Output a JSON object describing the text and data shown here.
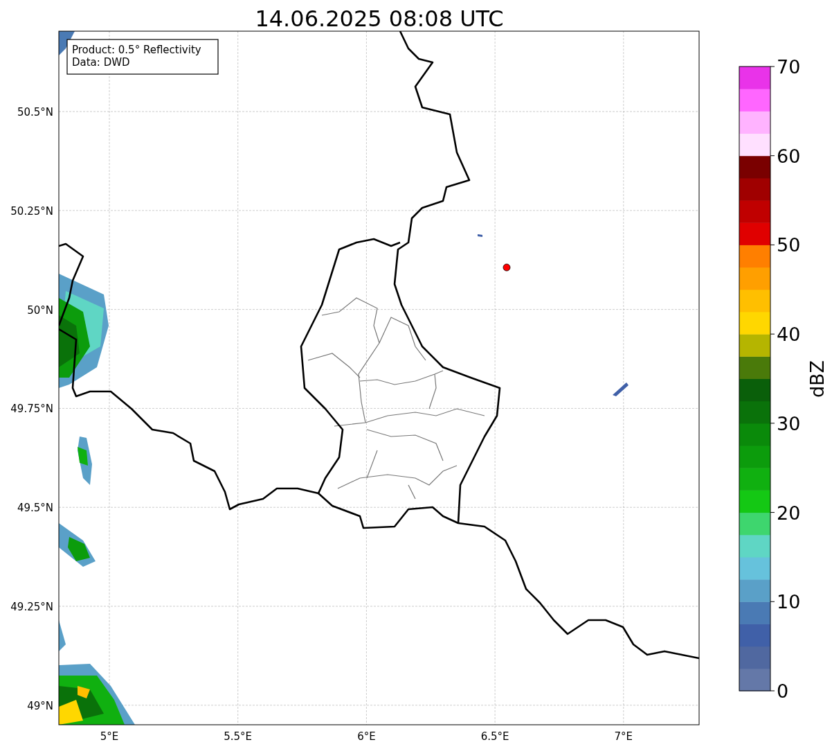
{
  "title": "14.06.2025 08:08 UTC",
  "legend": {
    "lines": [
      "Product: 0.5° Reflectivity",
      "Data: DWD"
    ]
  },
  "map": {
    "xtick_labels": [
      "5°E",
      "5.5°E",
      "6°E",
      "6.5°E",
      "7°E"
    ],
    "ytick_labels": [
      "50.5°N",
      "50.25°N",
      "50°N",
      "49.75°N",
      "49.5°N",
      "49.25°N",
      "49°N"
    ]
  },
  "colorbar": {
    "label": "dBZ",
    "tick_labels": [
      "70",
      "60",
      "50",
      "40",
      "30",
      "20",
      "10",
      "0"
    ],
    "bins": [
      {
        "color": "#6478a8"
      },
      {
        "color": "#5068a0"
      },
      {
        "color": "#4060a8"
      },
      {
        "color": "#4a7ab4"
      },
      {
        "color": "#5aa0c8"
      },
      {
        "color": "#66c2dc"
      },
      {
        "color": "#5fd6c4"
      },
      {
        "color": "#3ed66e"
      },
      {
        "color": "#14c814"
      },
      {
        "color": "#10b010"
      },
      {
        "color": "#0c9c0c"
      },
      {
        "color": "#0a8a0a"
      },
      {
        "color": "#0a720a"
      },
      {
        "color": "#0a5f0a"
      },
      {
        "color": "#4a7a0a"
      },
      {
        "color": "#b5b500"
      },
      {
        "color": "#ffd700"
      },
      {
        "color": "#ffbf00"
      },
      {
        "color": "#ff9f00"
      },
      {
        "color": "#ff7f00"
      },
      {
        "color": "#e00000"
      },
      {
        "color": "#c00000"
      },
      {
        "color": "#a00000"
      },
      {
        "color": "#7a0000"
      },
      {
        "color": "#ffe0ff"
      },
      {
        "color": "#ffb3ff"
      },
      {
        "color": "#ff66ff"
      },
      {
        "color": "#e933e9"
      }
    ]
  }
}
